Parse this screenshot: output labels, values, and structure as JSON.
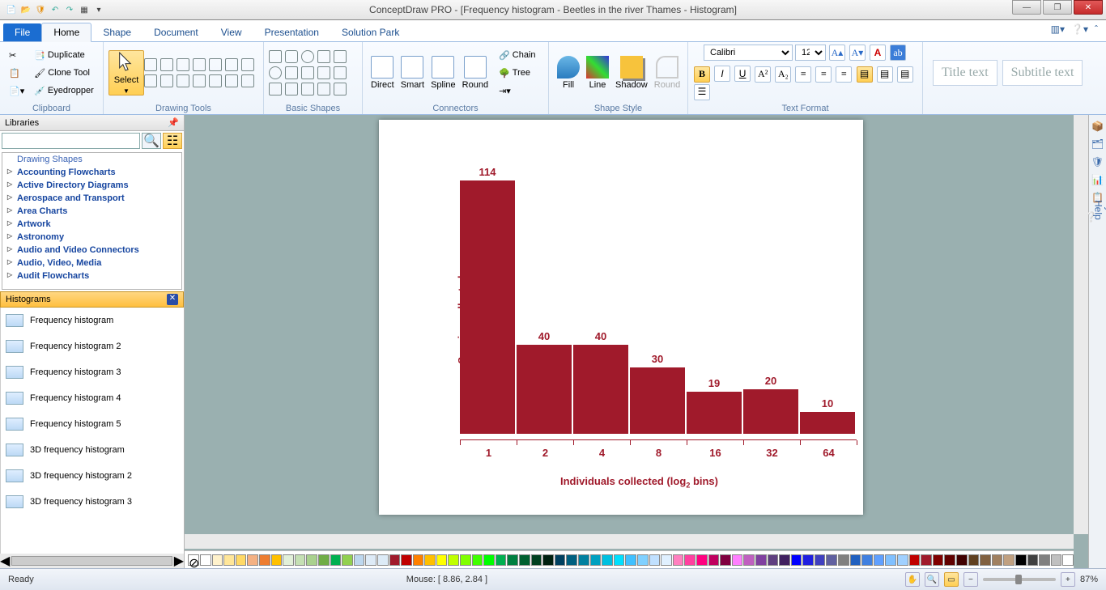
{
  "title": "ConceptDraw PRO - [Frequency histogram - Beetles in the river Thames - Histogram]",
  "menubar": {
    "file": "File",
    "home": "Home",
    "shape": "Shape",
    "document": "Document",
    "view": "View",
    "presentation": "Presentation",
    "solution_park": "Solution Park"
  },
  "ribbon": {
    "clipboard": {
      "label": "Clipboard",
      "duplicate": "Duplicate",
      "clone": "Clone Tool",
      "eyedropper": "Eyedropper"
    },
    "drawing": {
      "label": "Drawing Tools",
      "select": "Select"
    },
    "shapes": {
      "label": "Basic Shapes"
    },
    "connectors": {
      "label": "Connectors",
      "direct": "Direct",
      "smart": "Smart",
      "spline": "Spline",
      "round": "Round",
      "chain": "Chain",
      "tree": "Tree"
    },
    "shapestyle": {
      "label": "Shape Style",
      "fill": "Fill",
      "line": "Line",
      "shadow": "Shadow",
      "round": "Round"
    },
    "textformat": {
      "label": "Text Format",
      "font": "Calibri",
      "size": "12"
    },
    "title_text": "Title text",
    "subtitle_text": "Subtitle text"
  },
  "sidebar": {
    "libraries_title": "Libraries",
    "categories": [
      "Drawing Shapes",
      "Accounting Flowcharts",
      "Active Directory Diagrams",
      "Aerospace and Transport",
      "Area Charts",
      "Artwork",
      "Astronomy",
      "Audio and Video Connectors",
      "Audio, Video, Media",
      "Audit Flowcharts"
    ],
    "histograms_title": "Histograms",
    "histograms": [
      "Frequency histogram",
      "Frequency histogram 2",
      "Frequency histogram 3",
      "Frequency histogram 4",
      "Frequency histogram 5",
      "3D frequency histogram",
      "3D frequency histogram 2",
      "3D frequency histogram 3"
    ]
  },
  "chart_data": {
    "type": "bar",
    "categories": [
      "1",
      "2",
      "4",
      "8",
      "16",
      "32",
      "64"
    ],
    "values": [
      114,
      40,
      40,
      30,
      19,
      20,
      10
    ],
    "ylabel": "Species collected",
    "xlabel": "Individuals collected (log₂ bins)",
    "xlabel_html": "Individuals collected (log<sub>2</sub> bins)",
    "ylim": [
      0,
      120
    ]
  },
  "status": {
    "ready": "Ready",
    "mouse": "Mouse: [ 8.86, 2.84 ]",
    "zoom": "87%"
  },
  "dynamic_help": "Dynamic Help",
  "palette": [
    "#ffffff",
    "#fff2cc",
    "#ffe699",
    "#ffd966",
    "#f4b183",
    "#ed7d31",
    "#ffc000",
    "#e2f0d9",
    "#c5e0b4",
    "#a9d18e",
    "#70ad47",
    "#00b050",
    "#92d050",
    "#bdd7ee",
    "#deebf7",
    "#ddebf7",
    "#a01a2b",
    "#c00000",
    "#ff8000",
    "#ffbf00",
    "#ffff00",
    "#bfff00",
    "#80ff00",
    "#40ff00",
    "#00ff00",
    "#00b050",
    "#008040",
    "#006030",
    "#004020",
    "#002010",
    "#004060",
    "#006080",
    "#0080a0",
    "#00a0c0",
    "#00c0e0",
    "#00e0ff",
    "#40c0ff",
    "#80d0ff",
    "#c0e0ff",
    "#e0f0ff",
    "#ff80c0",
    "#ff40a0",
    "#ff0080",
    "#c00060",
    "#800040",
    "#ff80ff",
    "#c060c0",
    "#8040a0",
    "#604080",
    "#402060",
    "#0000ff",
    "#2020e0",
    "#4040c0",
    "#6060a0",
    "#808080",
    "#2060c0",
    "#4080e0",
    "#60a0ff",
    "#80c0ff",
    "#a0d0ff",
    "#c00000",
    "#a01a2b",
    "#800000",
    "#600000",
    "#400000",
    "#604020",
    "#806040",
    "#a08060",
    "#c0a080",
    "#000000",
    "#404040",
    "#808080",
    "#c0c0c0",
    "#ffffff"
  ]
}
